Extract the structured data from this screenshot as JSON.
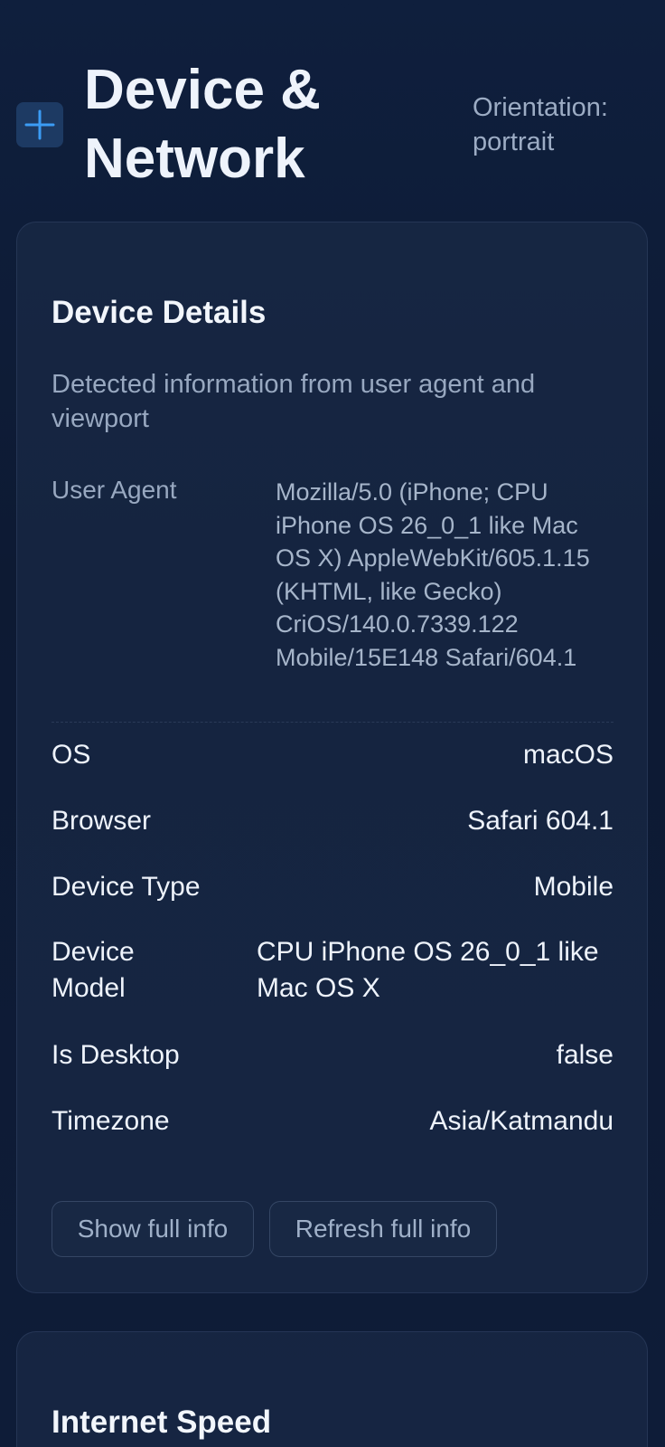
{
  "header": {
    "title": "Device & Network",
    "orientation": "Orientation: portrait",
    "logo_icon": "plus-icon",
    "accent_color": "#3b9cf5"
  },
  "device_card": {
    "title": "Device Details",
    "subtitle": "Detected information from user agent and viewport",
    "user_agent_label": "User Agent",
    "user_agent_value": "Mozilla/5.0 (iPhone; CPU iPhone OS 26_0_1 like Mac OS X) AppleWebKit/605.1.15 (KHTML, like Gecko) CriOS/140.0.7339.122 Mobile/15E148 Safari/604.1",
    "rows": [
      {
        "label": "OS",
        "value": "macOS"
      },
      {
        "label": "Browser",
        "value": "Safari 604.1"
      },
      {
        "label": "Device Type",
        "value": "Mobile"
      },
      {
        "label": "Device Model",
        "value": "CPU iPhone OS 26_0_1 like Mac OS X"
      },
      {
        "label": "Is Desktop",
        "value": "false"
      },
      {
        "label": "Timezone",
        "value": "Asia/Katmandu"
      }
    ],
    "show_full_info_label": "Show full info",
    "refresh_full_info_label": "Refresh full info"
  },
  "speed_card": {
    "title": "Internet Speed"
  }
}
